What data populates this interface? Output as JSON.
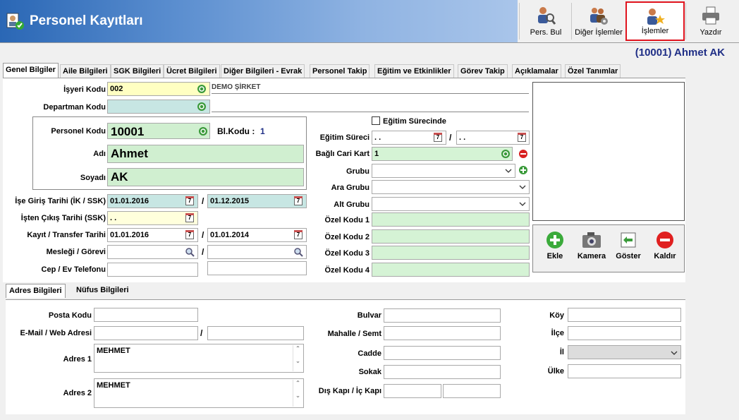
{
  "window": {
    "title": "Personel Kayıtları",
    "record_name": "(10001) Ahmet  AK"
  },
  "toolbar": {
    "pers_bul": "Pers. Bul",
    "diger_islemler": "Diğer İşlemler",
    "islemler": "İşlemler",
    "yazdir": "Yazdır"
  },
  "tabs": [
    "Genel Bilgiler",
    "Aile Bilgileri",
    "SGK Bilgileri",
    "Ücret Bilgileri",
    "Diğer Bilgileri - Evrak",
    "Personel Takip",
    "Eğitim ve Etkinlikler",
    "Görev Takip",
    "Açıklamalar",
    "Özel Tanımlar"
  ],
  "form": {
    "isyeri_kodu_label": "İşyeri Kodu",
    "isyeri_kodu": "002",
    "isyeri_adi": "DEMO ŞİRKET",
    "departman_kodu_label": "Departman Kodu",
    "departman_kodu": "",
    "personel_kodu_label": "Personel Kodu",
    "personel_kodu": "10001",
    "bl_kodu_label": "Bl.Kodu :",
    "bl_kodu": "1",
    "adi_label": "Adı",
    "adi": "Ahmet",
    "soyadi_label": "Soyadı",
    "soyadi": "AK",
    "ise_giris_label": "İşe Giriş Tarihi (İK / SSK)",
    "ise_giris_ik": "01.01.2016",
    "ise_giris_ssk": "01.12.2015",
    "isten_cikis_label": "İşten Çıkış Tarihi (SSK)",
    "isten_cikis": ". .",
    "kayit_transfer_label": "Kayıt / Transfer Tarihi",
    "kayit_tarihi": "01.01.2016",
    "transfer_tarihi": "01.01.2014",
    "meslegi_label": "Mesleği / Görevi",
    "meslegi": "",
    "gorevi": "",
    "cep_ev_label": "Cep / Ev Telefonu",
    "cep": "",
    "ev": "",
    "slash": "/",
    "egitim_surecinde_label": "Eğitim Sürecinde",
    "egitim_sureci_label": "Eğitim Süreci",
    "egitim_bas": ". .",
    "egitim_bit": ". .",
    "bagli_cari_label": "Bağlı Cari Kart",
    "bagli_cari": "1",
    "grubu_label": "Grubu",
    "ara_grubu_label": "Ara Grubu",
    "alt_grubu_label": "Alt Grubu",
    "ozel_kodu_1_label": "Özel Kodu 1",
    "ozel_kodu_2_label": "Özel Kodu 2",
    "ozel_kodu_3_label": "Özel Kodu 3",
    "ozel_kodu_4_label": "Özel Kodu 4"
  },
  "photo_buttons": {
    "ekle": "Ekle",
    "kamera": "Kamera",
    "goster": "Göster",
    "kaldir": "Kaldır"
  },
  "lower_tabs": [
    "Adres Bilgileri",
    "Nüfus Bilgileri"
  ],
  "address": {
    "posta_kodu_label": "Posta Kodu",
    "email_label": "E-Mail / Web Adresi",
    "adres1_label": "Adres 1",
    "adres1": "MEHMET",
    "adres2_label": "Adres 2",
    "adres2": "MEHMET",
    "bulvar_label": "Bulvar",
    "mahalle_label": "Mahalle / Semt",
    "cadde_label": "Cadde",
    "sokak_label": "Sokak",
    "dis_ic_kapi_label": "Dış Kapı / İç Kapı",
    "koy_label": "Köy",
    "ilce_label": "İlçe",
    "il_label": "İl",
    "ulke_label": "Ülke"
  },
  "colors": {
    "title_bar_start": "#2a67b5",
    "record_name": "#1f2e86",
    "selected_toolbar_border": "#e0141e"
  }
}
